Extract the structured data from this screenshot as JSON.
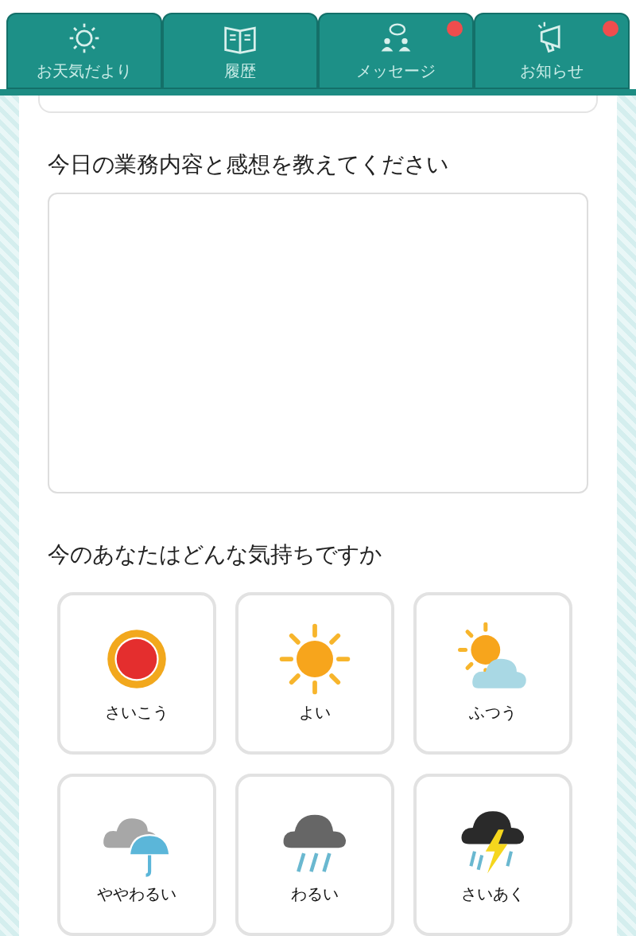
{
  "tabs": [
    {
      "label": "お天気だより",
      "kind": "sun",
      "badge": false
    },
    {
      "label": "履歴",
      "kind": "book",
      "badge": false
    },
    {
      "label": "メッセージ",
      "kind": "chat",
      "badge": true
    },
    {
      "label": "お知らせ",
      "kind": "megaphone",
      "badge": true
    }
  ],
  "report": {
    "question": "今日の業務内容と感想を教えてください"
  },
  "mood": {
    "question": "今のあなたはどんな気持ちですか",
    "options": [
      {
        "label": "さいこう",
        "kind": "best"
      },
      {
        "label": "よい",
        "kind": "good"
      },
      {
        "label": "ふつう",
        "kind": "fair"
      },
      {
        "label": "ややわるい",
        "kind": "somewhat_bad"
      },
      {
        "label": "わるい",
        "kind": "bad"
      },
      {
        "label": "さいあく",
        "kind": "worst"
      }
    ]
  }
}
